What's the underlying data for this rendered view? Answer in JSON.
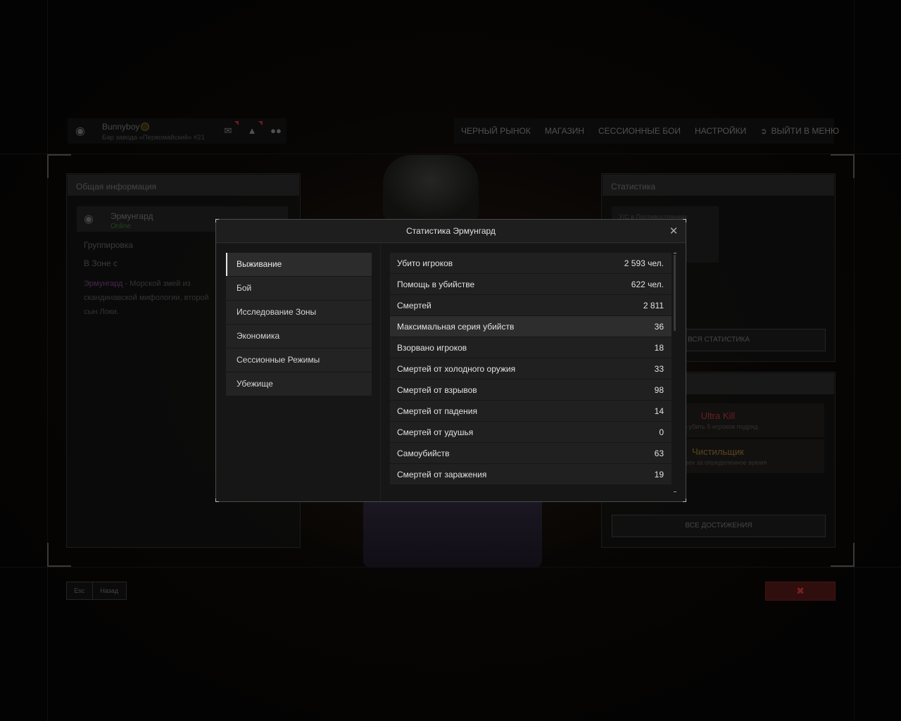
{
  "topbar": {
    "username": "Bunnyboy",
    "location": "Бар завода «Первомайский» #21",
    "nav": [
      "ЧЕРНЫЙ РЫНОК",
      "МАГАЗИН",
      "СЕССИОННЫЕ БОИ",
      "НАСТРОЙКИ"
    ],
    "exit_label": "ВЫЙТИ В МЕНЮ"
  },
  "info_panel": {
    "title": "Общая информация",
    "char_name": "Эрмунгард",
    "status": "Online",
    "faction_label": "Группировка",
    "zone_label": "В Зоне с",
    "desc_name": "Эрмунгард",
    "desc_text": " - Морской змей из скандинавской мифологии, второй сын Локи."
  },
  "stats_panel": {
    "title": "Статистика",
    "box_label": "У/С в Противостояниях",
    "all_stats_button": "ВСЯ СТАТИСТИКА"
  },
  "achievements": {
    "items": [
      {
        "title": "Ultra Kill",
        "sub": "...о убить 5 игроков подряд",
        "color": "#a03030"
      },
      {
        "title": "Чистильщик",
        "sub": "...еловек за определенное время",
        "color": "#8a6a2a"
      }
    ],
    "all_button": "ВСЕ ДОСТИЖЕНИЯ"
  },
  "bottom": {
    "esc": "Esc",
    "back": "Назад"
  },
  "modal": {
    "title": "Статистика Эрмунгард",
    "categories": [
      "Выживание",
      "Бой",
      "Исследование Зоны",
      "Экономика",
      "Сессионные Режимы",
      "Убежище"
    ],
    "active_category": "Выживание",
    "rows": [
      {
        "label": "Убито игроков",
        "value": "2 593 чел."
      },
      {
        "label": "Помощь в убийстве",
        "value": "622 чел."
      },
      {
        "label": "Смертей",
        "value": "2 811"
      },
      {
        "label": "Максимальная серия убийств",
        "value": "36"
      },
      {
        "label": "Взорвано игроков",
        "value": "18"
      },
      {
        "label": "Смертей от холодного оружия",
        "value": "33"
      },
      {
        "label": "Смертей от взрывов",
        "value": "98"
      },
      {
        "label": "Смертей от падения",
        "value": "14"
      },
      {
        "label": "Смертей от удушья",
        "value": "0"
      },
      {
        "label": "Самоубийств",
        "value": "63"
      },
      {
        "label": "Смертей от заражения",
        "value": "19"
      }
    ]
  },
  "colors": {
    "accent": "#e6e6e6",
    "notif": "#a52b2b",
    "exit_red": "#4a1616"
  }
}
